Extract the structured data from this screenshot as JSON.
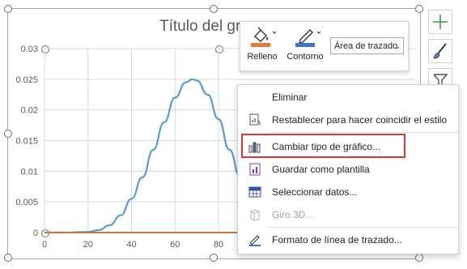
{
  "chart": {
    "title": "Título del gráfico",
    "accent": "#5b9bd5",
    "flat_line_color": "#c07a3e"
  },
  "chart_data": {
    "type": "line",
    "title": "Título del gráfico",
    "xlabel": "",
    "ylabel": "",
    "xlim": [
      0,
      100
    ],
    "ylim": [
      0,
      0.03
    ],
    "x_ticks": [
      "0",
      "20",
      "40",
      "60",
      "80"
    ],
    "y_ticks": [
      "0",
      "0.005",
      "0.01",
      "0.015",
      "0.02",
      "0.025",
      "0.03"
    ],
    "grid": true,
    "series": [
      {
        "x": [
          0,
          10,
          20,
          25,
          30,
          35,
          40,
          45,
          50,
          55,
          60,
          65,
          68,
          70,
          75,
          80,
          85,
          90
        ],
        "values": [
          0,
          0,
          0.0001,
          0.0004,
          0.0012,
          0.0028,
          0.0055,
          0.009,
          0.0135,
          0.018,
          0.022,
          0.0245,
          0.025,
          0.0248,
          0.0225,
          0.0185,
          0.0135,
          0.009
        ],
        "color": "#5b9bd5"
      },
      {
        "x": [
          0,
          100
        ],
        "values": [
          0,
          0
        ],
        "color": "#c07a3e"
      }
    ]
  },
  "toolbar": {
    "fill_label": "Relleno",
    "outline_label": "Contorno",
    "area_select_value": "Área de trazado",
    "fill_color": "#e07b39",
    "outline_color": "#4472c4"
  },
  "context_menu": {
    "items": [
      {
        "label": "Eliminar",
        "icon": "blank"
      },
      {
        "label": "Restablecer para hacer coincidir el estilo",
        "icon": "reset-style-icon"
      },
      {
        "label": "Cambiar tipo de gráfico...",
        "icon": "chart-type-icon"
      },
      {
        "label": "Guardar como plantilla",
        "icon": "save-template-icon"
      },
      {
        "label": "Seleccionar datos...",
        "icon": "select-data-icon"
      },
      {
        "label": "Giro 3D...",
        "icon": "rotation-3d-icon"
      },
      {
        "label": "Formato de línea de trazado...",
        "icon": "format-line-icon"
      }
    ],
    "highlight_color": "#e0353b"
  }
}
